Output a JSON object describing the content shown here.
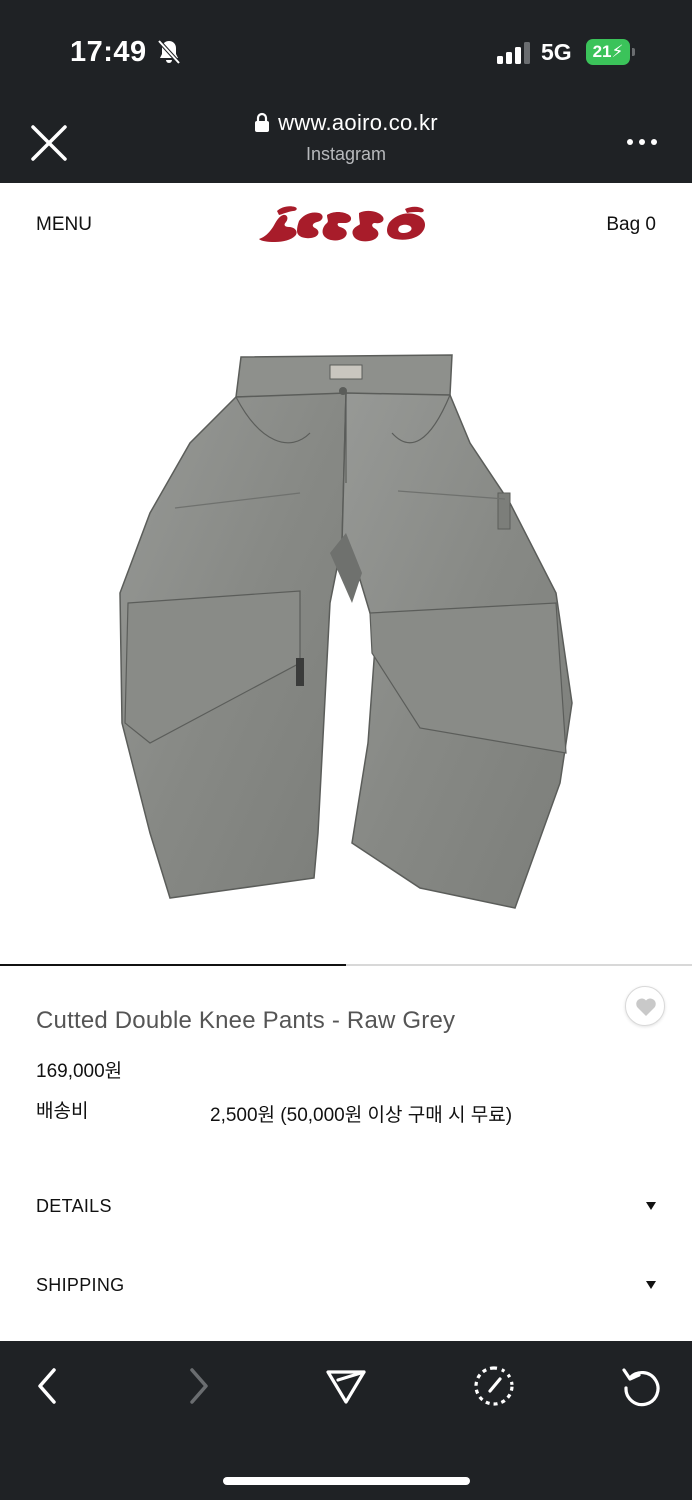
{
  "status_bar": {
    "time": "17:49",
    "network": "5G",
    "battery": "21",
    "icons": [
      "bell-slash-icon",
      "signal-icon",
      "battery-charging-icon"
    ]
  },
  "browser": {
    "url": "www.aoiro.co.kr",
    "subtitle": "Instagram",
    "icons": [
      "close-icon",
      "lock-icon",
      "more-icon"
    ]
  },
  "header": {
    "menu_label": "MENU",
    "bag_label": "Bag 0",
    "logo": "aoiro"
  },
  "product": {
    "title": "Cutted Double Knee Pants - Raw Grey",
    "price": "169,000원",
    "shipping_label": "배송비",
    "shipping_value": "2,500원 (50,000원 이상 구매 시 무료)",
    "image_index": 1,
    "image_count": 2,
    "image_colors": {
      "fabric": "#8b8d8a",
      "shadow": "#6f716e",
      "stitch": "#5b5d5a"
    }
  },
  "accordions": [
    {
      "label": "DETAILS"
    },
    {
      "label": "SHIPPING"
    }
  ],
  "toolbar": {
    "icons": [
      "back-icon",
      "forward-icon",
      "share-icon",
      "speed-icon",
      "reload-icon"
    ]
  },
  "colors": {
    "chrome": "#1f2225",
    "logo": "#a81c2a",
    "battery": "#3bc35a"
  }
}
